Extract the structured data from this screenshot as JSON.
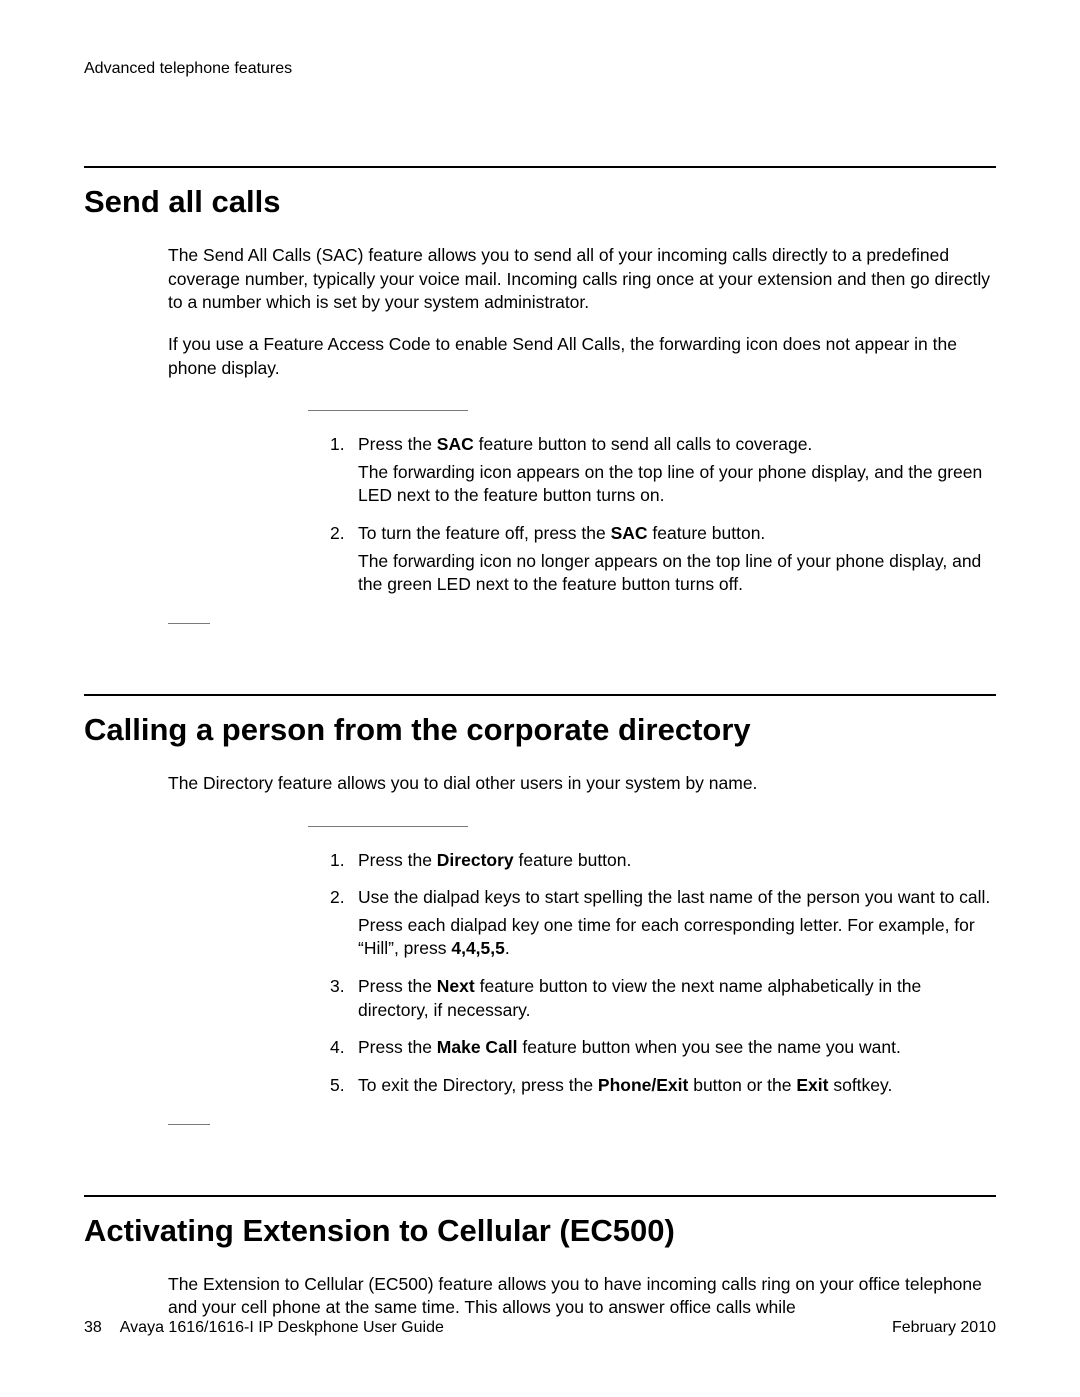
{
  "header": {
    "chapter": "Advanced telephone features"
  },
  "sections": [
    {
      "title": "Send all calls",
      "paras": [
        "The Send All Calls (SAC) feature allows you to send all of your incoming calls directly to a predefined coverage number, typically your voice mail. Incoming calls ring once at your extension and then go directly to a number which is set by your system administrator.",
        "If you use a Feature Access Code to enable Send All Calls, the forwarding icon does not appear in the phone display."
      ],
      "steps": [
        {
          "pre1": "Press the ",
          "bold1": "SAC",
          "post1": " feature button to send all calls to coverage.",
          "sub": "The forwarding icon appears on the top line of your phone display, and the green LED next to the feature button turns on."
        },
        {
          "pre1": "To turn the feature off, press the ",
          "bold1": "SAC",
          "post1": " feature button.",
          "sub": "The forwarding icon no longer appears on the top line of your phone display, and the green LED next to the feature button turns off."
        }
      ]
    },
    {
      "title": "Calling a person from the corporate directory",
      "paras": [
        "The Directory feature allows you to dial other users in your system by name."
      ],
      "steps": [
        {
          "pre1": "Press the ",
          "bold1": "Directory",
          "post1": " feature button."
        },
        {
          "pre1": "Use the dialpad keys to start spelling the last name of the person you want to call.",
          "sub_pre": "Press each dialpad key one time for each corresponding letter. For example, for “Hill”, press ",
          "sub_bold": "4,4,5,5",
          "sub_post": "."
        },
        {
          "pre1": "Press the ",
          "bold1": "Next",
          "post1": " feature button to view the next name alphabetically in the directory, if necessary."
        },
        {
          "pre1": "Press the ",
          "bold1": "Make Call",
          "post1": " feature button when you see the name you want."
        },
        {
          "pre1": "To exit the Directory, press the ",
          "bold1": "Phone/Exit",
          "post1": " button or the ",
          "bold2": "Exit",
          "post2": " softkey."
        }
      ]
    },
    {
      "title": "Activating Extension to Cellular (EC500)",
      "paras": [
        "The Extension to Cellular (EC500) feature allows you to have incoming calls ring on your office telephone and your cell phone at the same time. This allows you to answer office calls while"
      ],
      "steps": []
    }
  ],
  "footer": {
    "page": "38",
    "doc": "Avaya 1616/1616-I IP Deskphone User Guide",
    "date": "February 2010"
  }
}
